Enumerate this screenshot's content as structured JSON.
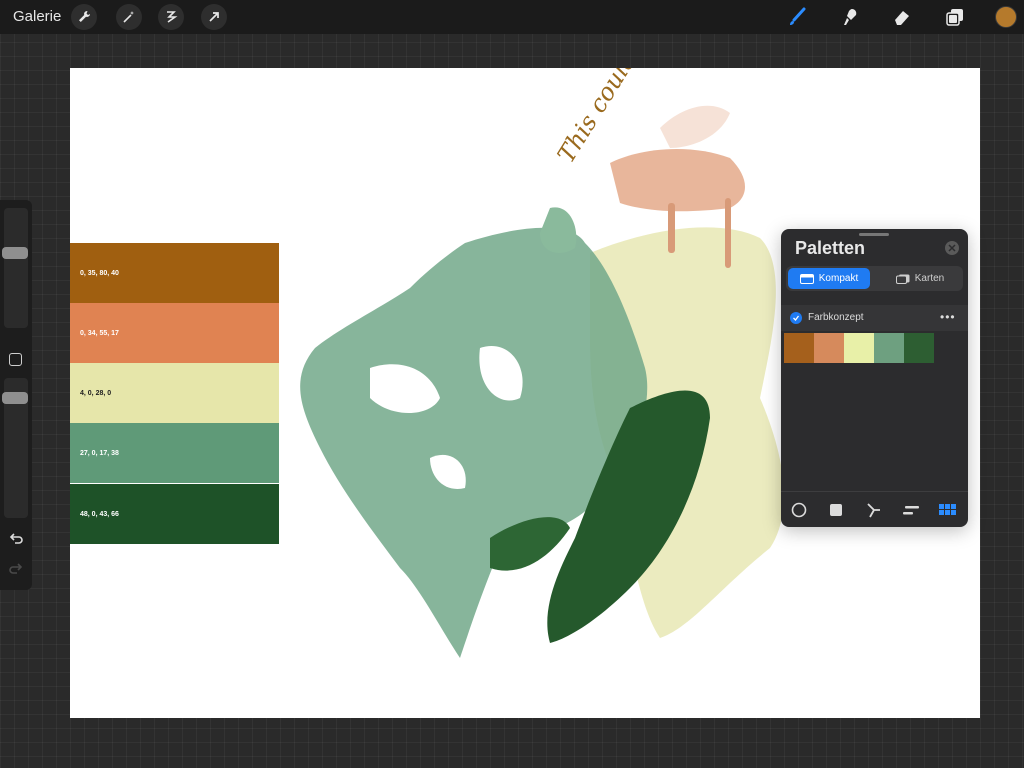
{
  "topbar": {
    "gallery_label": "Galerie",
    "tools_left": [
      "wrench-icon",
      "magic-wand-icon",
      "selection-icon",
      "transform-icon"
    ],
    "tools_right": [
      "brush-icon",
      "smudge-icon",
      "eraser-icon",
      "layers-icon"
    ],
    "current_color": "#b57a2c",
    "active_tool_color": "#2b8cff"
  },
  "canvas": {
    "handwriting": "This could be",
    "handwriting_color": "#9a6a1e",
    "swatches": [
      {
        "label": "0, 35, 80, 40",
        "color": "#a05f10",
        "text_color": "#ffffff"
      },
      {
        "label": "0, 34, 55, 17",
        "color": "#e08352",
        "text_color": "#ffffff"
      },
      {
        "label": "4, 0, 28, 0",
        "color": "#e6e6aa",
        "text_color": "#1e1e1e"
      },
      {
        "label": "27, 0, 17, 38",
        "color": "#5f9a78",
        "text_color": "#ffffff"
      },
      {
        "label": "48, 0, 43, 66",
        "color": "#1e5228",
        "text_color": "#ffffff"
      }
    ]
  },
  "palette_panel": {
    "title": "Paletten",
    "tabs": [
      {
        "label": "Kompakt",
        "active": true
      },
      {
        "label": "Karten",
        "active": false
      }
    ],
    "palette_name": "Farbkonzept",
    "palette_colors": [
      "#a5601c",
      "#d68a5c",
      "#e8f0a8",
      "#6ea080",
      "#2d5e32"
    ],
    "footer_icons": [
      "disc-icon",
      "classic-icon",
      "harmony-icon",
      "value-icon",
      "palettes-icon"
    ]
  }
}
